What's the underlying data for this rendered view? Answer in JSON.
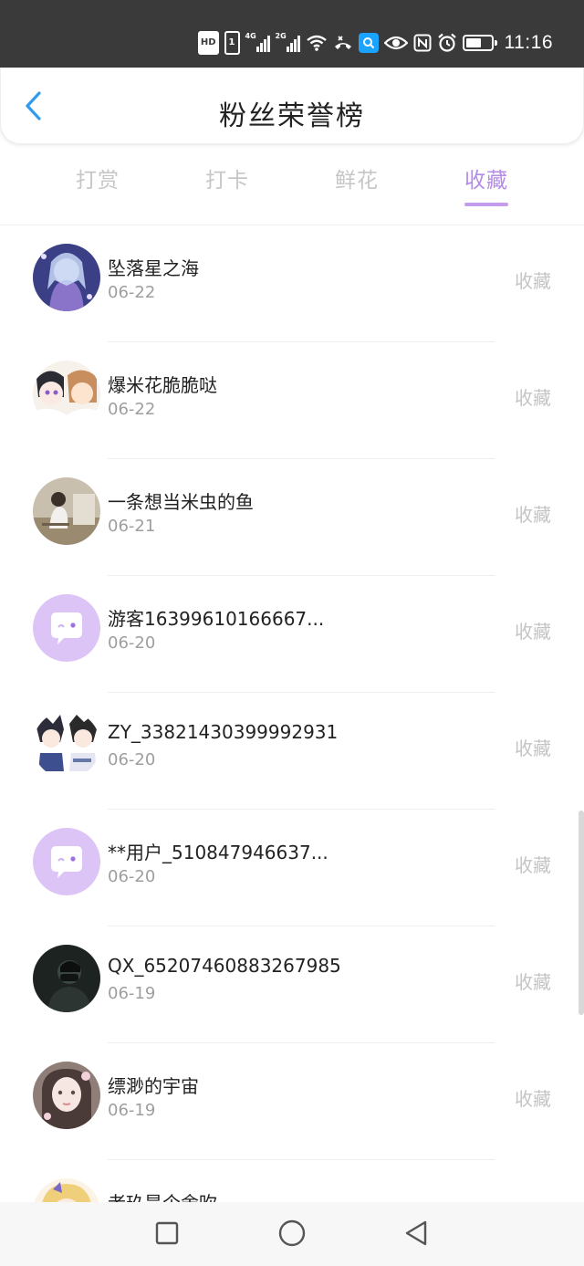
{
  "status_bar": {
    "time": "11:16",
    "hd_label": "HD",
    "sim_label": "1",
    "network1_label": "4G",
    "network2_label": "2G",
    "battery_level": 0.6,
    "icons": [
      "hd-icon",
      "sim-icon",
      "signal-4g-icon",
      "signal-2g-icon",
      "wifi-icon",
      "call-icon",
      "search-app-icon",
      "eye-icon",
      "nfc-icon",
      "alarm-icon",
      "battery-icon"
    ]
  },
  "header": {
    "title": "粉丝荣誉榜",
    "back_icon": "chevron-left-icon",
    "accent": "#2e9bf0"
  },
  "tabs": [
    {
      "label": "打赏",
      "active": false
    },
    {
      "label": "打卡",
      "active": false
    },
    {
      "label": "鲜花",
      "active": false
    },
    {
      "label": "收藏",
      "active": true
    }
  ],
  "theme": {
    "active_tab_color": "#b48be6",
    "inactive_text": "#c6c6c6",
    "guest_avatar_bg": "#d8bff5"
  },
  "list": [
    {
      "name": "坠落星之海",
      "date": "06-22",
      "action": "收藏",
      "avatar": "anime-character-avatar"
    },
    {
      "name": "爆米花脆脆哒",
      "date": "06-22",
      "action": "收藏",
      "avatar": "anime-duo-avatar"
    },
    {
      "name": "一条想当米虫的鱼",
      "date": "06-21",
      "action": "收藏",
      "avatar": "photo-avatar"
    },
    {
      "name": "游客16399610166667...",
      "date": "06-20",
      "action": "收藏",
      "avatar": "default-chat-avatar"
    },
    {
      "name": "ZY_33821430399992931",
      "date": "06-20",
      "action": "收藏",
      "avatar": "anime-duo-avatar"
    },
    {
      "name": "**用户_510847946637...",
      "date": "06-20",
      "action": "收藏",
      "avatar": "default-chat-avatar"
    },
    {
      "name": "QX_65207460883267985",
      "date": "06-19",
      "action": "收藏",
      "avatar": "dark-photo-avatar"
    },
    {
      "name": "缥渺的宇宙",
      "date": "06-19",
      "action": "收藏",
      "avatar": "portrait-avatar"
    },
    {
      "name": "老玖是个舍吹",
      "date": "",
      "action": "",
      "avatar": "anime-character-avatar"
    }
  ],
  "nav_bar": {
    "icons": [
      "recent-apps-icon",
      "home-icon",
      "back-icon"
    ]
  }
}
